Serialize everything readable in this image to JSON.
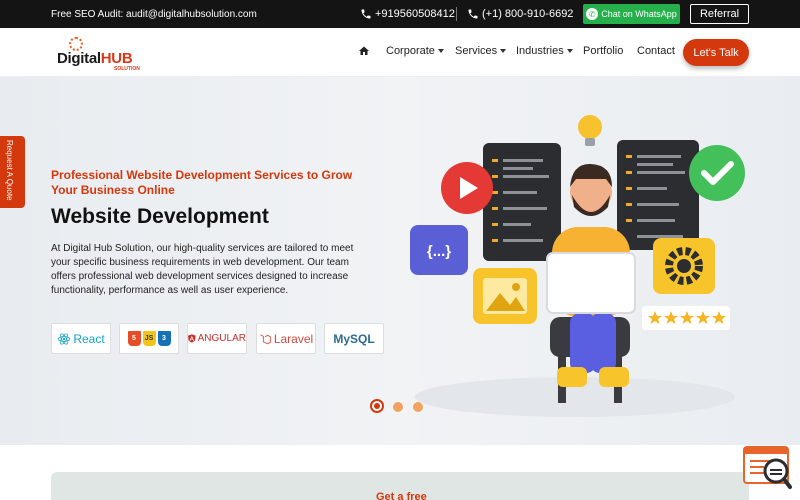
{
  "topbar": {
    "email_text": "Free SEO Audit: audit@digitalhubsolution.com",
    "phone1": "+919560508412",
    "phone2": "(+1) 800-910-6692",
    "whatsapp_label": "Chat on WhatsApp",
    "referral_label": "Referral"
  },
  "header": {
    "logo": {
      "word1": "Digital",
      "word2": "HUB",
      "sub": "SOLUTION"
    },
    "nav": {
      "corporate": "Corporate",
      "services": "Services",
      "industries": "Industries",
      "portfolio": "Portfolio",
      "contact": "Contact"
    },
    "cta_label": "Let's Talk"
  },
  "hero": {
    "quote_tab": "Request A Quote",
    "subtitle": "Professional Website Development Services to Grow Your Business Online",
    "title": "Website Development",
    "description": "At Digital Hub Solution, our high-quality services are tailored to meet your specific business requirements in web development. Our team offers professional web development services designed to increase functionality, performance as well as user experience.",
    "tech": {
      "react": "React",
      "html_badges": [
        "5",
        "3",
        "JS"
      ],
      "angular": "ANGULAR",
      "laravel": "Laravel",
      "mysql": "MySQL"
    },
    "illustration": {
      "code_placeholder": "{...}",
      "rating_stars": 5
    },
    "carousel": {
      "slides": 3,
      "active_index": 0
    }
  },
  "bottom": {
    "card_title": "Get a free"
  },
  "colors": {
    "accent": "#d4380d",
    "whatsapp": "#25b04c",
    "topbar_bg": "#141414"
  }
}
